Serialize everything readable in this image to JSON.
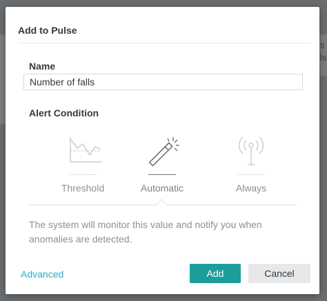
{
  "dialog": {
    "title": "Add to Pulse",
    "name_label": "Name",
    "name_value": "Number of falls",
    "alert_label": "Alert Condition",
    "options": [
      {
        "label": "Threshold",
        "icon": "threshold-chart-icon",
        "selected": false
      },
      {
        "label": "Automatic",
        "icon": "magic-wand-icon",
        "selected": true
      },
      {
        "label": "Always",
        "icon": "broadcast-antenna-icon",
        "selected": false
      }
    ],
    "description": "The system will monitor this value and notify you when anomalies are detected.",
    "advanced_link": "Advanced",
    "add_label": "Add",
    "cancel_label": "Cancel"
  },
  "background": {
    "fragments": [
      "s",
      "ls"
    ]
  },
  "colors": {
    "accent": "#1b9d9c",
    "link": "#2aa9c9",
    "overlay": "#6a6d70"
  }
}
